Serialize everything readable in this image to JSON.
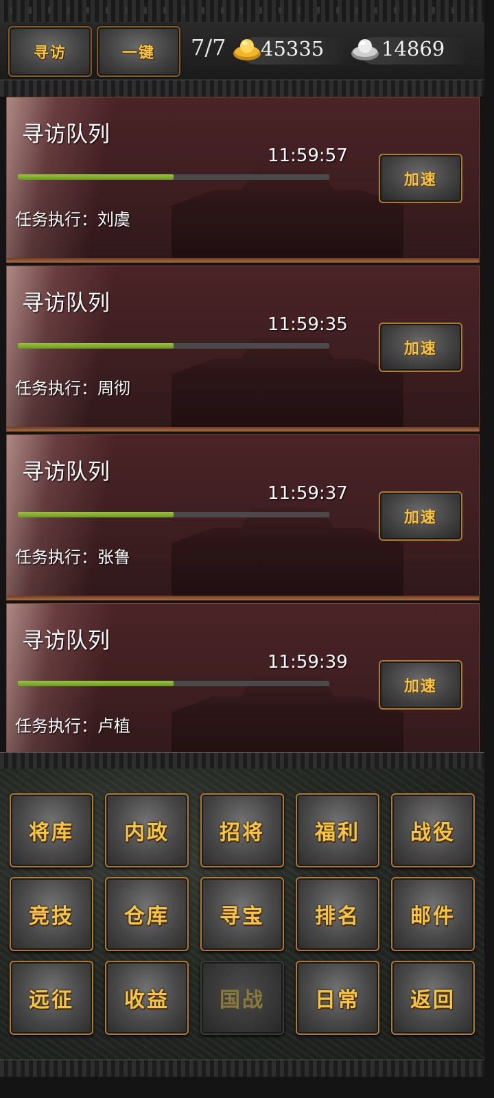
{
  "top_bar": {
    "visit_button": "寻访",
    "onekey_button": "一键",
    "queue_count": "7/7",
    "gold_value": "45335",
    "silver_value": "14869"
  },
  "queues": [
    {
      "title": "寻访队列",
      "timer": "11:59:57",
      "worker": "任务执行：刘虞",
      "progress": 0.5,
      "button": "加速"
    },
    {
      "title": "寻访队列",
      "timer": "11:59:35",
      "worker": "任务执行：周彻",
      "progress": 0.5,
      "button": "加速"
    },
    {
      "title": "寻访队列",
      "timer": "11:59:37",
      "worker": "任务执行：张鲁",
      "progress": 0.5,
      "button": "加速"
    },
    {
      "title": "寻访队列",
      "timer": "11:59:39",
      "worker": "任务执行：卢植",
      "progress": 0.5,
      "button": "加速"
    }
  ],
  "menu": {
    "rows": [
      [
        "将库",
        "内政",
        "招将",
        "福利",
        "战役"
      ],
      [
        "竞技",
        "仓库",
        "寻宝",
        "排名",
        "邮件"
      ],
      [
        "远征",
        "收益",
        "国战",
        "日常",
        "返回"
      ]
    ],
    "disabled": [
      "国战"
    ]
  },
  "colors": {
    "button_text": "#f6c640",
    "button_border": "#b07a2e",
    "progress_fill": "#8cb832",
    "card_bg": "#4a2326"
  },
  "icons": {
    "gold": "gold-ingot-icon",
    "silver": "silver-ingot-icon"
  }
}
